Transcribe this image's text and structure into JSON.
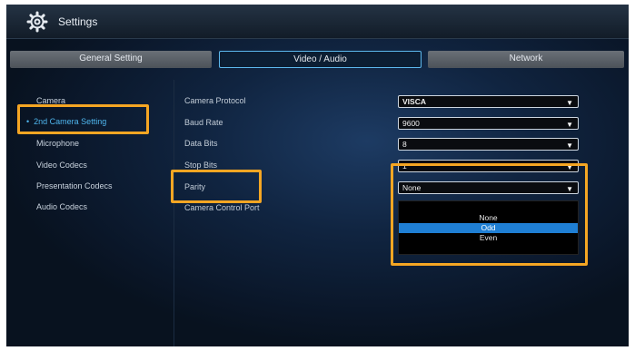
{
  "window": {
    "title": "Settings"
  },
  "tabs": [
    {
      "label": "General Setting",
      "active": false
    },
    {
      "label": "Video / Audio",
      "active": true
    },
    {
      "label": "Network",
      "active": false
    }
  ],
  "sidebar": {
    "items": [
      {
        "label": "Camera",
        "active": false
      },
      {
        "label": "2nd Camera Setting",
        "active": true
      },
      {
        "label": "Microphone",
        "active": false
      },
      {
        "label": "Video Codecs",
        "active": false
      },
      {
        "label": "Presentation Codecs",
        "active": false
      },
      {
        "label": "Audio Codecs",
        "active": false
      }
    ]
  },
  "form": {
    "camera_protocol": {
      "label": "Camera Protocol",
      "value": "VISCA"
    },
    "baud_rate": {
      "label": "Baud Rate",
      "value": "9600"
    },
    "data_bits": {
      "label": "Data Bits",
      "value": "8"
    },
    "stop_bits": {
      "label": "Stop Bits",
      "value": "1"
    },
    "parity": {
      "label": "Parity",
      "value": "None"
    },
    "camera_control_port": {
      "label": "Camera Control Port"
    }
  },
  "parity_dropdown": {
    "options": [
      "None",
      "Odd",
      "Even"
    ],
    "highlighted": "Odd"
  },
  "icons": {
    "settings": "gear-icon",
    "dropdown": "triangle-down-icon"
  },
  "colors": {
    "accent": "#4fb6ee",
    "highlight": "#f5a623",
    "selected_option": "#1f7fd4"
  }
}
